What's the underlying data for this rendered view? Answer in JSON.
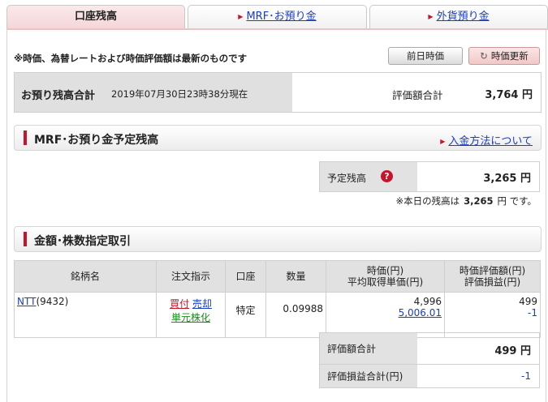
{
  "tabs": [
    {
      "label": "口座残高",
      "active": true
    },
    {
      "label": "MRF･お預り金",
      "active": false
    },
    {
      "label": "外貨預り金",
      "active": false
    }
  ],
  "notice": "※時価、為替レートおよび時価評価額は最新のものです",
  "buttons": {
    "prev_day": "前日時価",
    "refresh": "時価更新"
  },
  "summary": {
    "title": "お預り残高合計",
    "datetime": "2019年07月30日23時38分現在",
    "eval_label": "評価額合計",
    "eval_value": "3,764 円"
  },
  "mrf_section": {
    "title": "MRF･お預り金予定残高",
    "link": "入金方法について",
    "scheduled_label": "予定残高",
    "scheduled_value": "3,265 円",
    "note_prefix": "※本日の残高は",
    "note_amount": "3,265",
    "note_suffix": "円 です。"
  },
  "trade_section": {
    "title": "金額･株数指定取引",
    "columns": [
      "銘柄名",
      "注文指示",
      "口座",
      "数量",
      "時価(円)",
      "平均取得単価(円)",
      "時価評価額(円)",
      "評価損益(円)"
    ],
    "rows": [
      {
        "name": "NTT",
        "code": "(9432)",
        "buy": "買付",
        "sell": "売却",
        "unit": "単元株化",
        "account": "特定",
        "quantity": "0.09988",
        "price": "4,996",
        "avg_price": "5,006.01",
        "market_value": "499",
        "pl": "-1"
      }
    ]
  },
  "totals": {
    "eval_label": "評価額合計",
    "eval_value": "499 円",
    "pl_label": "評価損益合計(円)",
    "pl_value": "-1"
  },
  "colors": {
    "accent": "#c8142a",
    "link": "#1a3fc4",
    "tab_active": "#f4d5d7"
  },
  "icons": {
    "refresh": "refresh-icon",
    "help": "question-circle-icon",
    "arrow": "triangle-right-icon"
  }
}
